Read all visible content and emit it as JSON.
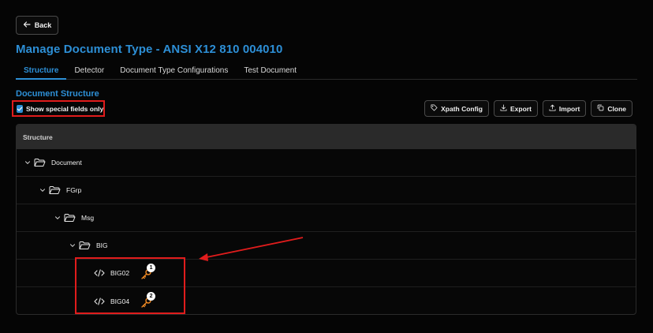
{
  "header": {
    "back_label": "Back",
    "title": "Manage Document Type - ANSI X12 810 004010"
  },
  "tabs": [
    {
      "label": "Structure",
      "active": true
    },
    {
      "label": "Detector",
      "active": false
    },
    {
      "label": "Document Type Configurations",
      "active": false
    },
    {
      "label": "Test Document",
      "active": false
    }
  ],
  "section": {
    "title": "Document Structure",
    "special_fields_label": "Show special fields only",
    "special_fields_checked": true
  },
  "toolbar": {
    "xpath_label": "Xpath Config",
    "export_label": "Export",
    "import_label": "Import",
    "clone_label": "Clone"
  },
  "tree": {
    "header": "Structure",
    "nodes": [
      {
        "label": "Document",
        "type": "folder",
        "depth": 0
      },
      {
        "label": "FGrp",
        "type": "folder",
        "depth": 1
      },
      {
        "label": "Msg",
        "type": "folder",
        "depth": 2
      },
      {
        "label": "BIG",
        "type": "folder",
        "depth": 3
      },
      {
        "label": "BIG02",
        "type": "field",
        "depth": 4,
        "badge": "1"
      },
      {
        "label": "BIG04",
        "type": "field",
        "depth": 4,
        "badge": "2"
      }
    ]
  },
  "colors": {
    "accent": "#2d8fd6",
    "annotation": "#e01c1c",
    "key_icon": "#f08a24",
    "background": "#050505"
  }
}
